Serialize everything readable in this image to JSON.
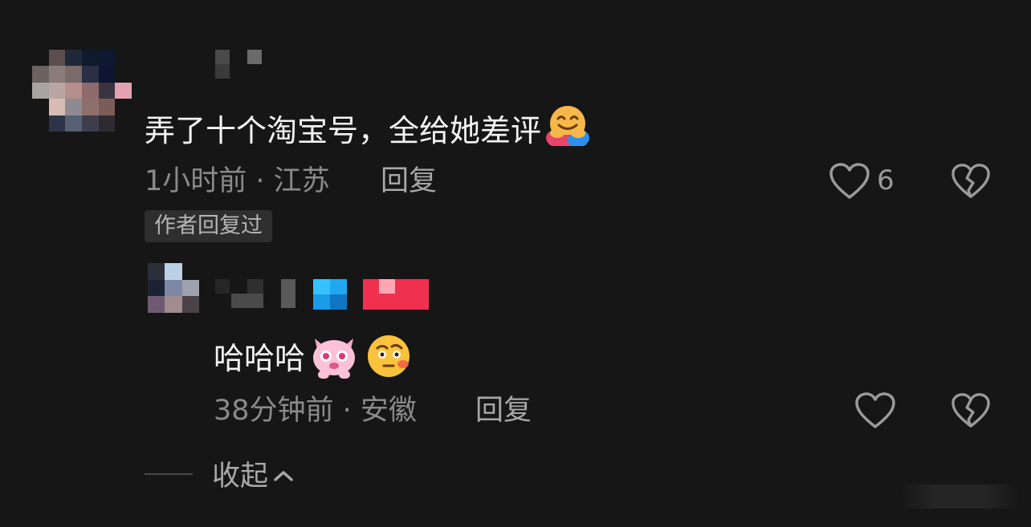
{
  "comment": {
    "text": "弄了十个淘宝号，全给她差评",
    "emoji_icon": "hugging-face-icon",
    "time_location": "1小时前 · 江苏",
    "reply_label": "回复",
    "like_count": "6",
    "author_replied_badge": "作者回复过"
  },
  "reply": {
    "text": "哈哈哈",
    "emoji_icons": [
      "pink-cat-sticker-icon",
      "face-with-hand-over-mouth-icon"
    ],
    "time_location": "38分钟前 · 安徽",
    "reply_label": "回复"
  },
  "collapse_label": "收起",
  "colors": {
    "background": "#161616",
    "badge_bg": "#2e2e2e",
    "secondary_text": "#8a8a8a"
  }
}
